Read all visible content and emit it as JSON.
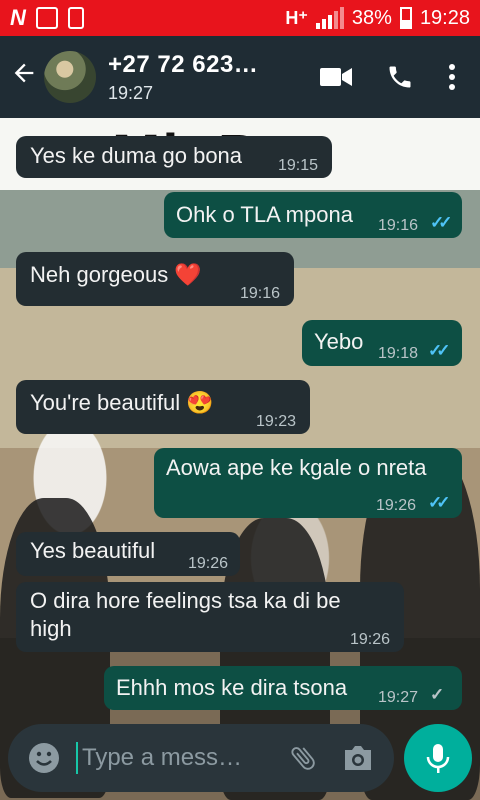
{
  "status_bar": {
    "network": "H⁺",
    "battery": "38%",
    "clock": "19:28"
  },
  "header": {
    "contact_name": "+27 72 623…",
    "last_seen": "19:27"
  },
  "background": {
    "text": "Mb  Pru"
  },
  "messages": [
    {
      "text": "Yes ke duma go bona",
      "time": "19:15",
      "dir": "in"
    },
    {
      "text": "Ohk o TLA mpona",
      "time": "19:16",
      "dir": "out",
      "status": "read"
    },
    {
      "text": "Neh gorgeous ❤️",
      "time": "19:16",
      "dir": "in"
    },
    {
      "text": "Yebo",
      "time": "19:18",
      "dir": "out",
      "status": "read"
    },
    {
      "text": "You're beautiful 😍",
      "time": "19:23",
      "dir": "in"
    },
    {
      "text": "Aowa ape ke kgale o nreta",
      "time": "19:26",
      "dir": "out",
      "status": "read"
    },
    {
      "text": "Yes beautiful",
      "time": "19:26",
      "dir": "in"
    },
    {
      "text": "O dira hore feelings tsa ka di be high",
      "time": "19:26",
      "dir": "in"
    },
    {
      "text": "Ehhh mos ke dira tsona",
      "time": "19:27",
      "dir": "out",
      "status": "sent"
    }
  ],
  "input": {
    "placeholder": "Type a mess…"
  },
  "colors": {
    "status_bar": "#e8141c",
    "header": "#1f2c34",
    "incoming_bubble": "#232d32",
    "outgoing_bubble": "#0d4f44",
    "read_tick": "#4fc3f7",
    "mic_button": "#00af9c"
  },
  "icons": {
    "back": "arrow-left-icon",
    "video": "video-camera-icon",
    "call": "phone-icon",
    "menu": "more-vertical-icon",
    "emoji": "emoji-icon",
    "attach": "paperclip-icon",
    "camera": "camera-icon",
    "mic": "microphone-icon"
  }
}
